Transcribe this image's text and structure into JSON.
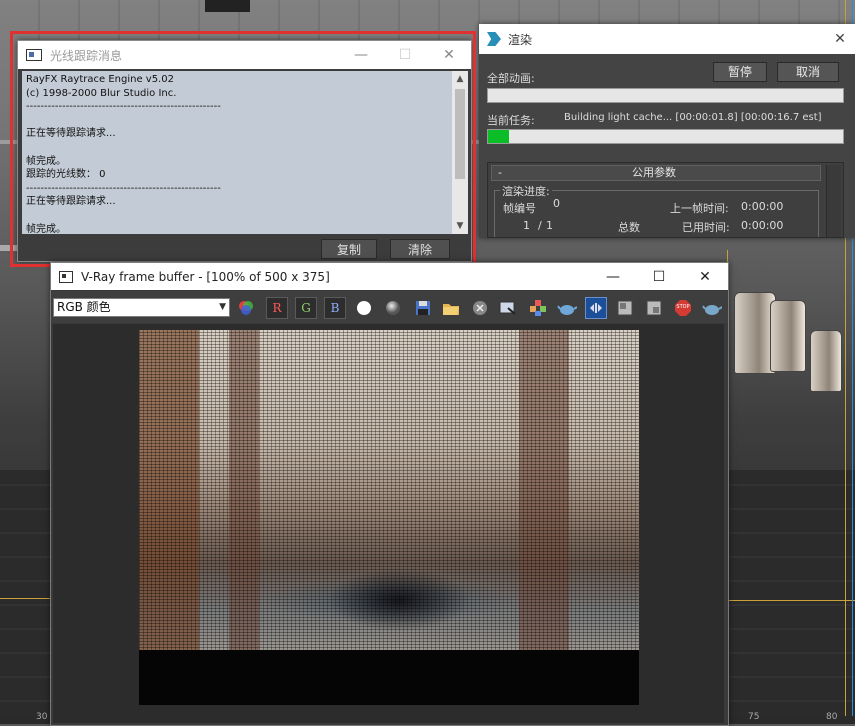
{
  "raytrace_window": {
    "title": "光线跟踪消息",
    "log_lines": [
      "RayFX Raytrace Engine v5.02",
      "(c) 1998-2000 Blur Studio Inc.",
      "------------------------------------------------------",
      "",
      "正在等待跟踪请求...",
      "",
      "帧完成。",
      "跟踪的光线数： 0",
      "------------------------------------------------------",
      "正在等待跟踪请求...",
      "",
      "帧完成。"
    ],
    "copy_label": "复制",
    "clear_label": "清除"
  },
  "render_window": {
    "title": "渲染",
    "pause_label": "暂停",
    "cancel_label": "取消",
    "all_animation_label": "全部动画:",
    "all_animation_progress": 0,
    "current_task_label": "当前任务:",
    "current_task_text": "Building light cache... [00:00:01.8] [00:00:16.7 est]",
    "current_task_progress": 0.06,
    "rollout_title": "公用参数",
    "rollout_collapse": "-",
    "render_progress_label": "渲染进度:",
    "frame_number_label": "帧编号",
    "frame_number_value": "0",
    "prev_frame_time_label": "上一帧时间:",
    "prev_frame_time_value": "0:00:00",
    "frame_count_current": "1",
    "frame_count_sep": "/",
    "frame_count_total": "1",
    "total_label": "总数",
    "elapsed_label": "已用时间:",
    "elapsed_value": "0:00:00"
  },
  "vfb_window": {
    "title": "V-Ray frame buffer - [100% of 500 x 375]",
    "channel": "RGB 颜色",
    "tool_red_label": "R",
    "tool_green_label": "G",
    "tool_blue_label": "B",
    "tool_stop_label": "STOP"
  },
  "viewport": {
    "ruler_left": "30",
    "ruler_75": "75",
    "ruler_80": "80"
  },
  "colors": {
    "progress_green": "#0bbd26",
    "highlight_red": "#e0302f",
    "log_background": "#c3ccd6"
  }
}
